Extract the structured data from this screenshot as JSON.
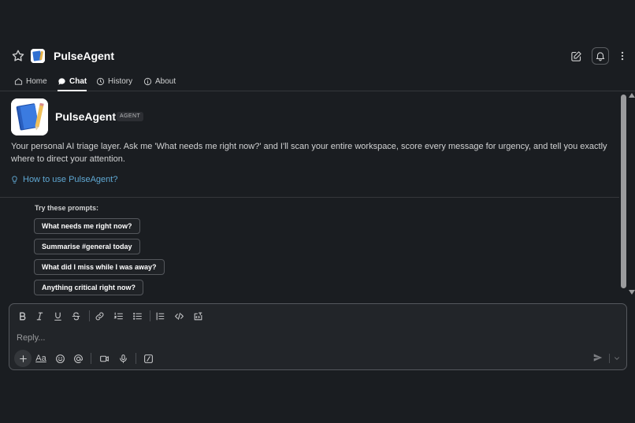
{
  "header": {
    "title": "PulseAgent",
    "icons": [
      "star-icon",
      "app-logo-icon",
      "compose-icon",
      "bell-icon",
      "more-vertical-icon"
    ]
  },
  "tabs": [
    {
      "label": "Home",
      "icon": "home-icon",
      "active": false
    },
    {
      "label": "Chat",
      "icon": "chat-bubble-icon",
      "active": true
    },
    {
      "label": "History",
      "icon": "clock-icon",
      "active": false
    },
    {
      "label": "About",
      "icon": "info-icon",
      "active": false
    }
  ],
  "agent": {
    "name": "PulseAgent",
    "badge": "AGENT",
    "description": "Your personal AI triage layer. Ask me 'What needs me right now?' and I'll scan your entire workspace, score every message for urgency, and tell you exactly where to direct your attention.",
    "howto_link": "How to use PulseAgent?"
  },
  "prompts": {
    "label": "Try these prompts:",
    "items": [
      "What needs me right now?",
      "Summarise #general today",
      "What did I miss while I was away?",
      "Anything critical right now?"
    ]
  },
  "composer": {
    "placeholder": "Reply...",
    "format_label": "Aa"
  },
  "colors": {
    "background": "#1a1d21",
    "link": "#5fa8d3",
    "text": "#d1d2d3"
  }
}
